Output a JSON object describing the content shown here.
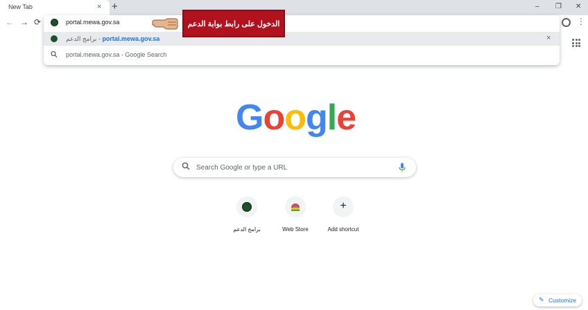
{
  "browser": {
    "tab_title": "New Tab",
    "tab_close": "×",
    "new_tab": "+",
    "window_controls": {
      "minimize": "–",
      "maximize": "❐",
      "close": "✕"
    },
    "nav": {
      "back": "←",
      "forward": "→",
      "reload": "⟳"
    },
    "menu": "⋮"
  },
  "omnibox": {
    "value": "portal.mewa.gov.sa",
    "suggestions": [
      {
        "title": "برامج الدعم",
        "separator": " - ",
        "url": "portal.mewa.gov.sa",
        "remove": "×"
      },
      {
        "text": "portal.mewa.gov.sa - Google Search"
      }
    ]
  },
  "annotation": {
    "text": "الدخول على رابط بوابة الدعم"
  },
  "google": {
    "logo_letters": [
      "G",
      "o",
      "o",
      "g",
      "l",
      "e"
    ],
    "logo_colors": [
      "#4285f4",
      "#ea4335",
      "#fbbc05",
      "#4285f4",
      "#34a853",
      "#ea4335"
    ],
    "search_placeholder": "Search Google or type a URL"
  },
  "shortcuts": [
    {
      "label": "برامج الدعم"
    },
    {
      "label": "Web Store"
    },
    {
      "label": "Add shortcut",
      "icon": "+"
    }
  ],
  "customize": {
    "label": "Customize",
    "icon": "✎"
  },
  "colors": {
    "accent": "#1a73e8",
    "callout": "#b0121e",
    "tab_strip": "#dee1e6"
  }
}
